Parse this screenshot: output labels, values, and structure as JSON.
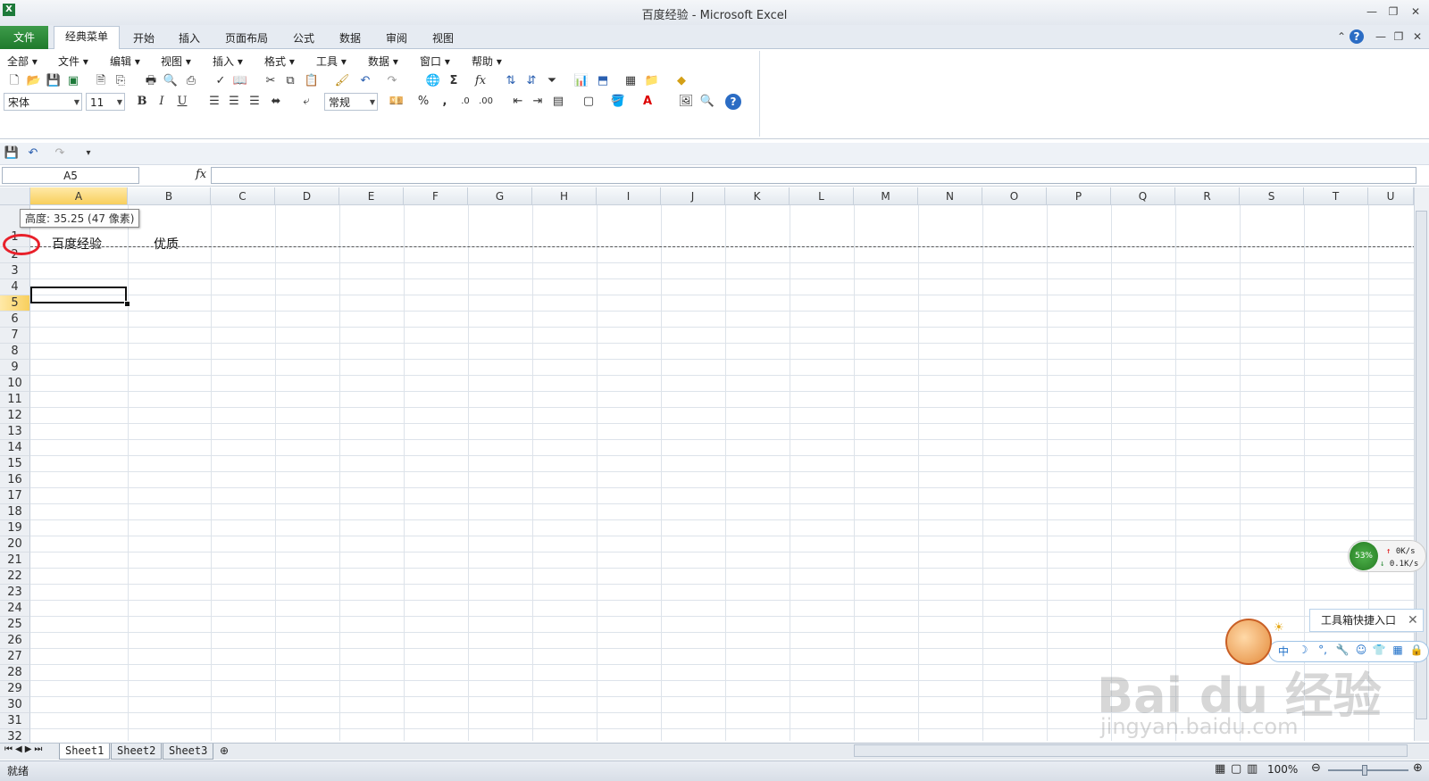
{
  "window": {
    "title": "百度经验 - Microsoft Excel"
  },
  "ribbon_tabs": [
    "文件",
    "经典菜单",
    "开始",
    "插入",
    "页面布局",
    "公式",
    "数据",
    "审阅",
    "视图"
  ],
  "classic_menu": [
    "全部",
    "文件",
    "编辑",
    "视图",
    "插入",
    "格式",
    "工具",
    "数据",
    "窗口",
    "帮助"
  ],
  "toolbar": {
    "font_name": "宋体",
    "font_size": "11",
    "bold": "B",
    "italic": "I",
    "underline": "U",
    "number_format": "常规",
    "percent": "%",
    "comma": ","
  },
  "formula_bar": {
    "name_box": "A5",
    "fx": "fx",
    "value": ""
  },
  "columns": [
    "A",
    "B",
    "C",
    "D",
    "E",
    "F",
    "G",
    "H",
    "I",
    "J",
    "K",
    "L",
    "M",
    "N",
    "O",
    "P",
    "Q",
    "R",
    "S",
    "T",
    "U"
  ],
  "selected_column": "A",
  "rows": [
    "1",
    "2",
    "3",
    "4",
    "5",
    "6",
    "7",
    "8",
    "9",
    "10",
    "11",
    "12",
    "13",
    "14",
    "15",
    "16",
    "17",
    "18",
    "19",
    "20",
    "21",
    "22",
    "23",
    "24",
    "25",
    "26",
    "27",
    "28",
    "29",
    "30",
    "31",
    "32"
  ],
  "selected_row": "5",
  "cells": {
    "A1": "百度经验",
    "B1": "优质"
  },
  "row_height_tooltip": "高度: 35.25 (47 像素)",
  "sheet_tabs": [
    "Sheet1",
    "Sheet2",
    "Sheet3"
  ],
  "active_sheet": "Sheet1",
  "status": {
    "mode": "就绪",
    "zoom": "100%"
  },
  "overlays": {
    "net_monitor": {
      "percent": "53%",
      "up": "0K/s",
      "down": "0.1K/s"
    },
    "ime_tooltip": "工具箱快捷入口",
    "ime_lang": "中",
    "watermark": "Bai du 经验",
    "watermark_url": "jingyan.baidu.com"
  },
  "colors": {
    "file_tab": "#2a8a36",
    "selection_header": "#f8cf5c",
    "highlight_circle": "#e8202a"
  }
}
